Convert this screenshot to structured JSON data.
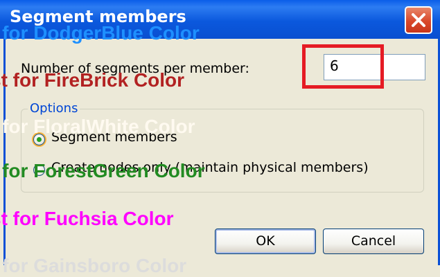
{
  "dialog": {
    "title": "Segment members",
    "close_icon": "close-icon",
    "segments_label": "Number of segments per member:",
    "segments_value": "6",
    "options": {
      "legend": "Options",
      "radio_segment": "Segment members",
      "radio_create_nodes": "Create nodes only (maintain physical members)",
      "selected": "segment"
    },
    "ok_label": "OK",
    "cancel_label": "Cancel"
  },
  "overlays": [
    {
      "text": "t for DodgerBlue Color",
      "color": "#1E90FF"
    },
    {
      "text": "st for FireBrick Color",
      "color": "#B22222"
    },
    {
      "text": "t for FloralWhite Color",
      "color": "#FFFAF0"
    },
    {
      "text": "t for ForestGreen Color",
      "color": "#228B22"
    },
    {
      "text": "st for Fuchsia Color",
      "color": "#FF00FF"
    },
    {
      "text": "t for Gainsboro Color",
      "color": "#DCDCDC"
    }
  ],
  "colors": {
    "titlebar": "#0a5ee8",
    "highlight": "#e51b24",
    "face": "#ece9d8"
  }
}
